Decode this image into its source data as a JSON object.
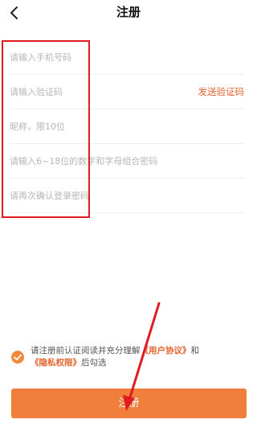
{
  "header": {
    "title": "注册"
  },
  "form": {
    "phone_placeholder": "请输入手机号码",
    "code_placeholder": "请输入验证码",
    "send_code_label": "发送验证码",
    "nickname_placeholder": "昵称，限10位",
    "password_placeholder": "请输入6~18位的数字和字母组合密码",
    "confirm_placeholder": "请再次确认登录密码"
  },
  "agreement": {
    "prefix": "请注册前认证阅读并充分理解",
    "user_agreement": "《用户协议》",
    "and": "和",
    "privacy": "《隐私权限》",
    "suffix": "后勾选"
  },
  "register_button_label": "注册",
  "colors": {
    "accent": "#f07f3c",
    "link": "#e4632d",
    "annotation": "#e11b22"
  },
  "icons": {
    "back": "chevron-left-icon",
    "check": "check-circle-icon",
    "arrow": "arrow-annotation-icon"
  }
}
